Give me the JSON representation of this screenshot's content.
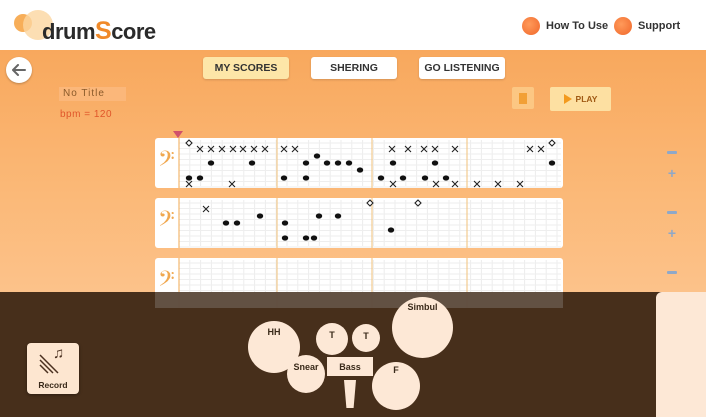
{
  "header": {
    "logo_left": "drum",
    "logo_hl": "S",
    "logo_right": "core",
    "links": [
      {
        "label": "How To Use"
      },
      {
        "label": "Support"
      }
    ]
  },
  "nav": {
    "back_icon": "arrow-left-icon",
    "tabs": [
      {
        "label": "MY SCORES",
        "active": true
      },
      {
        "label": "SHERING",
        "active": false
      },
      {
        "label": "GO LISTENING",
        "active": false
      }
    ]
  },
  "score": {
    "title": "No Title",
    "bpm_label": "bpm = 120",
    "play_label": "PLAY"
  },
  "controls": {
    "record_label": "Record"
  },
  "drums": {
    "hh": "HH",
    "tom1": "T",
    "tom2": "T",
    "simbul": "Simbul",
    "snear": "Snear",
    "bass": "Bass",
    "floor": "F"
  },
  "colors": {
    "accent": "#f08a2a",
    "background_top": "#f8a85d",
    "overlay": "#41281a",
    "drum_pad": "#fde8d6"
  }
}
